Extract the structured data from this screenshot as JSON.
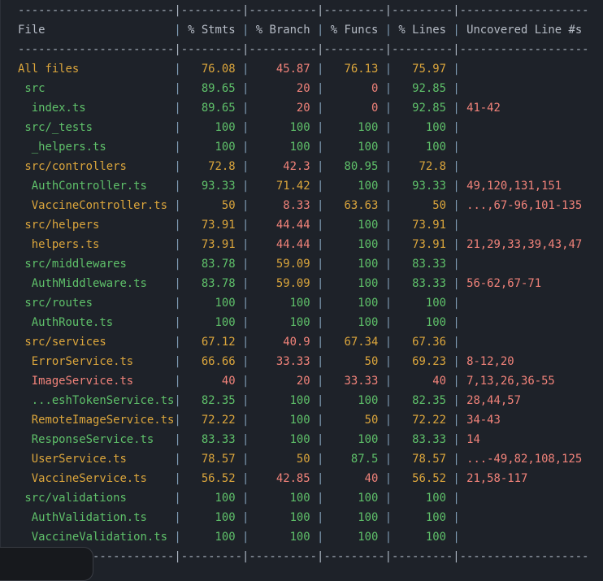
{
  "terminal": {
    "separator_line": "-----------------------|---------|----------|---------|---------|-------------------",
    "header": {
      "file": "File",
      "stmts": "% Stmts",
      "branch": "% Branch",
      "funcs": "% Funcs",
      "lines": "% Lines",
      "uncovered": "Uncovered Line #s"
    },
    "colors": {
      "high": "#5fc16a",
      "medium": "#dca63c",
      "low": "#f2837a",
      "background": "#1e2229"
    },
    "rows": [
      {
        "file": "All files",
        "indent": 0,
        "name_c": "y",
        "stmts": "76.08",
        "stmts_c": "y",
        "branch": "45.87",
        "branch_c": "r",
        "funcs": "76.13",
        "funcs_c": "y",
        "lines": "75.97",
        "lines_c": "y",
        "uncovered": ""
      },
      {
        "file": "src",
        "indent": 1,
        "name_c": "g",
        "stmts": "89.65",
        "stmts_c": "g",
        "branch": "20",
        "branch_c": "r",
        "funcs": "0",
        "funcs_c": "r",
        "lines": "92.85",
        "lines_c": "g",
        "uncovered": ""
      },
      {
        "file": "index.ts",
        "indent": 2,
        "name_c": "g",
        "stmts": "89.65",
        "stmts_c": "g",
        "branch": "20",
        "branch_c": "r",
        "funcs": "0",
        "funcs_c": "r",
        "lines": "92.85",
        "lines_c": "g",
        "uncovered": "41-42"
      },
      {
        "file": "src/_tests",
        "indent": 1,
        "name_c": "g",
        "stmts": "100",
        "stmts_c": "g",
        "branch": "100",
        "branch_c": "g",
        "funcs": "100",
        "funcs_c": "g",
        "lines": "100",
        "lines_c": "g",
        "uncovered": ""
      },
      {
        "file": "_helpers.ts",
        "indent": 2,
        "name_c": "g",
        "stmts": "100",
        "stmts_c": "g",
        "branch": "100",
        "branch_c": "g",
        "funcs": "100",
        "funcs_c": "g",
        "lines": "100",
        "lines_c": "g",
        "uncovered": ""
      },
      {
        "file": "src/controllers",
        "indent": 1,
        "name_c": "y",
        "stmts": "72.8",
        "stmts_c": "y",
        "branch": "42.3",
        "branch_c": "r",
        "funcs": "80.95",
        "funcs_c": "g",
        "lines": "72.8",
        "lines_c": "y",
        "uncovered": ""
      },
      {
        "file": "AuthController.ts",
        "indent": 2,
        "name_c": "g",
        "stmts": "93.33",
        "stmts_c": "g",
        "branch": "71.42",
        "branch_c": "y",
        "funcs": "100",
        "funcs_c": "g",
        "lines": "93.33",
        "lines_c": "g",
        "uncovered": "49,120,131,151"
      },
      {
        "file": "VaccineController.ts",
        "indent": 2,
        "name_c": "y",
        "stmts": "50",
        "stmts_c": "y",
        "branch": "8.33",
        "branch_c": "r",
        "funcs": "63.63",
        "funcs_c": "y",
        "lines": "50",
        "lines_c": "y",
        "uncovered": "...,67-96,101-135"
      },
      {
        "file": "src/helpers",
        "indent": 1,
        "name_c": "y",
        "stmts": "73.91",
        "stmts_c": "y",
        "branch": "44.44",
        "branch_c": "r",
        "funcs": "100",
        "funcs_c": "g",
        "lines": "73.91",
        "lines_c": "y",
        "uncovered": ""
      },
      {
        "file": "helpers.ts",
        "indent": 2,
        "name_c": "y",
        "stmts": "73.91",
        "stmts_c": "y",
        "branch": "44.44",
        "branch_c": "r",
        "funcs": "100",
        "funcs_c": "g",
        "lines": "73.91",
        "lines_c": "y",
        "uncovered": "21,29,33,39,43,47"
      },
      {
        "file": "src/middlewares",
        "indent": 1,
        "name_c": "g",
        "stmts": "83.78",
        "stmts_c": "g",
        "branch": "59.09",
        "branch_c": "y",
        "funcs": "100",
        "funcs_c": "g",
        "lines": "83.33",
        "lines_c": "g",
        "uncovered": ""
      },
      {
        "file": "AuthMiddleware.ts",
        "indent": 2,
        "name_c": "g",
        "stmts": "83.78",
        "stmts_c": "g",
        "branch": "59.09",
        "branch_c": "y",
        "funcs": "100",
        "funcs_c": "g",
        "lines": "83.33",
        "lines_c": "g",
        "uncovered": "56-62,67-71"
      },
      {
        "file": "src/routes",
        "indent": 1,
        "name_c": "g",
        "stmts": "100",
        "stmts_c": "g",
        "branch": "100",
        "branch_c": "g",
        "funcs": "100",
        "funcs_c": "g",
        "lines": "100",
        "lines_c": "g",
        "uncovered": ""
      },
      {
        "file": "AuthRoute.ts",
        "indent": 2,
        "name_c": "g",
        "stmts": "100",
        "stmts_c": "g",
        "branch": "100",
        "branch_c": "g",
        "funcs": "100",
        "funcs_c": "g",
        "lines": "100",
        "lines_c": "g",
        "uncovered": ""
      },
      {
        "file": "src/services",
        "indent": 1,
        "name_c": "y",
        "stmts": "67.12",
        "stmts_c": "y",
        "branch": "40.9",
        "branch_c": "r",
        "funcs": "67.34",
        "funcs_c": "y",
        "lines": "67.36",
        "lines_c": "y",
        "uncovered": ""
      },
      {
        "file": "ErrorService.ts",
        "indent": 2,
        "name_c": "y",
        "stmts": "66.66",
        "stmts_c": "y",
        "branch": "33.33",
        "branch_c": "r",
        "funcs": "50",
        "funcs_c": "y",
        "lines": "69.23",
        "lines_c": "y",
        "uncovered": "8-12,20"
      },
      {
        "file": "ImageService.ts",
        "indent": 2,
        "name_c": "r",
        "stmts": "40",
        "stmts_c": "r",
        "branch": "20",
        "branch_c": "r",
        "funcs": "33.33",
        "funcs_c": "r",
        "lines": "40",
        "lines_c": "r",
        "uncovered": "7,13,26,36-55"
      },
      {
        "file": "...eshTokenService.ts",
        "indent": 2,
        "name_c": "g",
        "stmts": "82.35",
        "stmts_c": "g",
        "branch": "100",
        "branch_c": "g",
        "funcs": "100",
        "funcs_c": "g",
        "lines": "82.35",
        "lines_c": "g",
        "uncovered": "28,44,57"
      },
      {
        "file": "RemoteImageService.ts",
        "indent": 2,
        "name_c": "y",
        "stmts": "72.22",
        "stmts_c": "y",
        "branch": "100",
        "branch_c": "g",
        "funcs": "50",
        "funcs_c": "y",
        "lines": "72.22",
        "lines_c": "y",
        "uncovered": "34-43"
      },
      {
        "file": "ResponseService.ts",
        "indent": 2,
        "name_c": "g",
        "stmts": "83.33",
        "stmts_c": "g",
        "branch": "100",
        "branch_c": "g",
        "funcs": "100",
        "funcs_c": "g",
        "lines": "83.33",
        "lines_c": "g",
        "uncovered": "14"
      },
      {
        "file": "UserService.ts",
        "indent": 2,
        "name_c": "y",
        "stmts": "78.57",
        "stmts_c": "y",
        "branch": "50",
        "branch_c": "y",
        "funcs": "87.5",
        "funcs_c": "g",
        "lines": "78.57",
        "lines_c": "y",
        "uncovered": "...-49,82,108,125"
      },
      {
        "file": "VaccineService.ts",
        "indent": 2,
        "name_c": "y",
        "stmts": "56.52",
        "stmts_c": "y",
        "branch": "42.85",
        "branch_c": "r",
        "funcs": "40",
        "funcs_c": "r",
        "lines": "56.52",
        "lines_c": "y",
        "uncovered": "21,58-117"
      },
      {
        "file": "src/validations",
        "indent": 1,
        "name_c": "g",
        "stmts": "100",
        "stmts_c": "g",
        "branch": "100",
        "branch_c": "g",
        "funcs": "100",
        "funcs_c": "g",
        "lines": "100",
        "lines_c": "g",
        "uncovered": ""
      },
      {
        "file": "AuthValidation.ts",
        "indent": 2,
        "name_c": "g",
        "stmts": "100",
        "stmts_c": "g",
        "branch": "100",
        "branch_c": "g",
        "funcs": "100",
        "funcs_c": "g",
        "lines": "100",
        "lines_c": "g",
        "uncovered": ""
      },
      {
        "file": "VaccineValidation.ts",
        "indent": 2,
        "name_c": "g",
        "stmts": "100",
        "stmts_c": "g",
        "branch": "100",
        "branch_c": "g",
        "funcs": "100",
        "funcs_c": "g",
        "lines": "100",
        "lines_c": "g",
        "uncovered": ""
      }
    ]
  }
}
